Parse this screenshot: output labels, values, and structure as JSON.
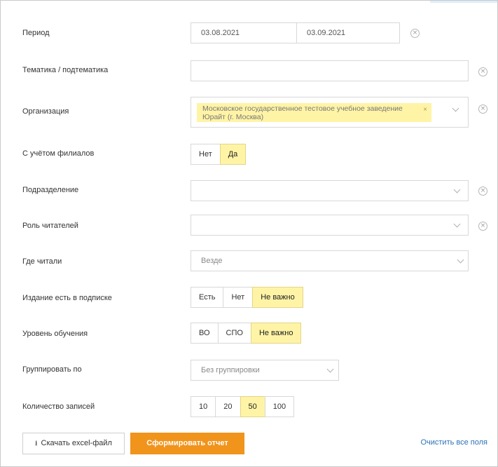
{
  "period": {
    "label": "Период",
    "date_from": "03.08.2021",
    "date_to": "03.09.2021",
    "clear_icon": "×"
  },
  "topic": {
    "label": "Тематика / подтематика",
    "value": "",
    "clear_icon": "×"
  },
  "organization": {
    "label": "Организация",
    "tag": "Московское государственное тестовое учебное заведение Юрайт (г. Москва)",
    "tag_remove": "×",
    "clear_icon": "×"
  },
  "branches": {
    "label": "С учётом филиалов",
    "options": [
      "Нет",
      "Да"
    ],
    "active": "Да"
  },
  "department": {
    "label": "Подразделение",
    "value": "",
    "clear_icon": "×"
  },
  "reader_role": {
    "label": "Роль читателей",
    "value": "",
    "clear_icon": "×"
  },
  "where_read": {
    "label": "Где читали",
    "value": "Везде"
  },
  "subscription": {
    "label": "Издание есть в подписке",
    "options": [
      "Есть",
      "Нет",
      "Не важно"
    ],
    "active": "Не важно"
  },
  "education_level": {
    "label": "Уровень обучения",
    "options": [
      "ВО",
      "СПО",
      "Не важно"
    ],
    "active": "Не важно"
  },
  "group_by": {
    "label": "Группировать по",
    "value": "Без группировки"
  },
  "records_count": {
    "label": "Количество записей",
    "options": [
      "10",
      "20",
      "50",
      "100"
    ],
    "active": "50"
  },
  "actions": {
    "download_icon": "⭳",
    "download_label": "Скачать excel-файл",
    "submit_label": "Сформировать отчет",
    "clear_all_label": "Очистить все поля"
  },
  "colors": {
    "accent_orange": "#f0941c",
    "active_yellow": "#fff4a6",
    "link_blue": "#2a73b6"
  }
}
